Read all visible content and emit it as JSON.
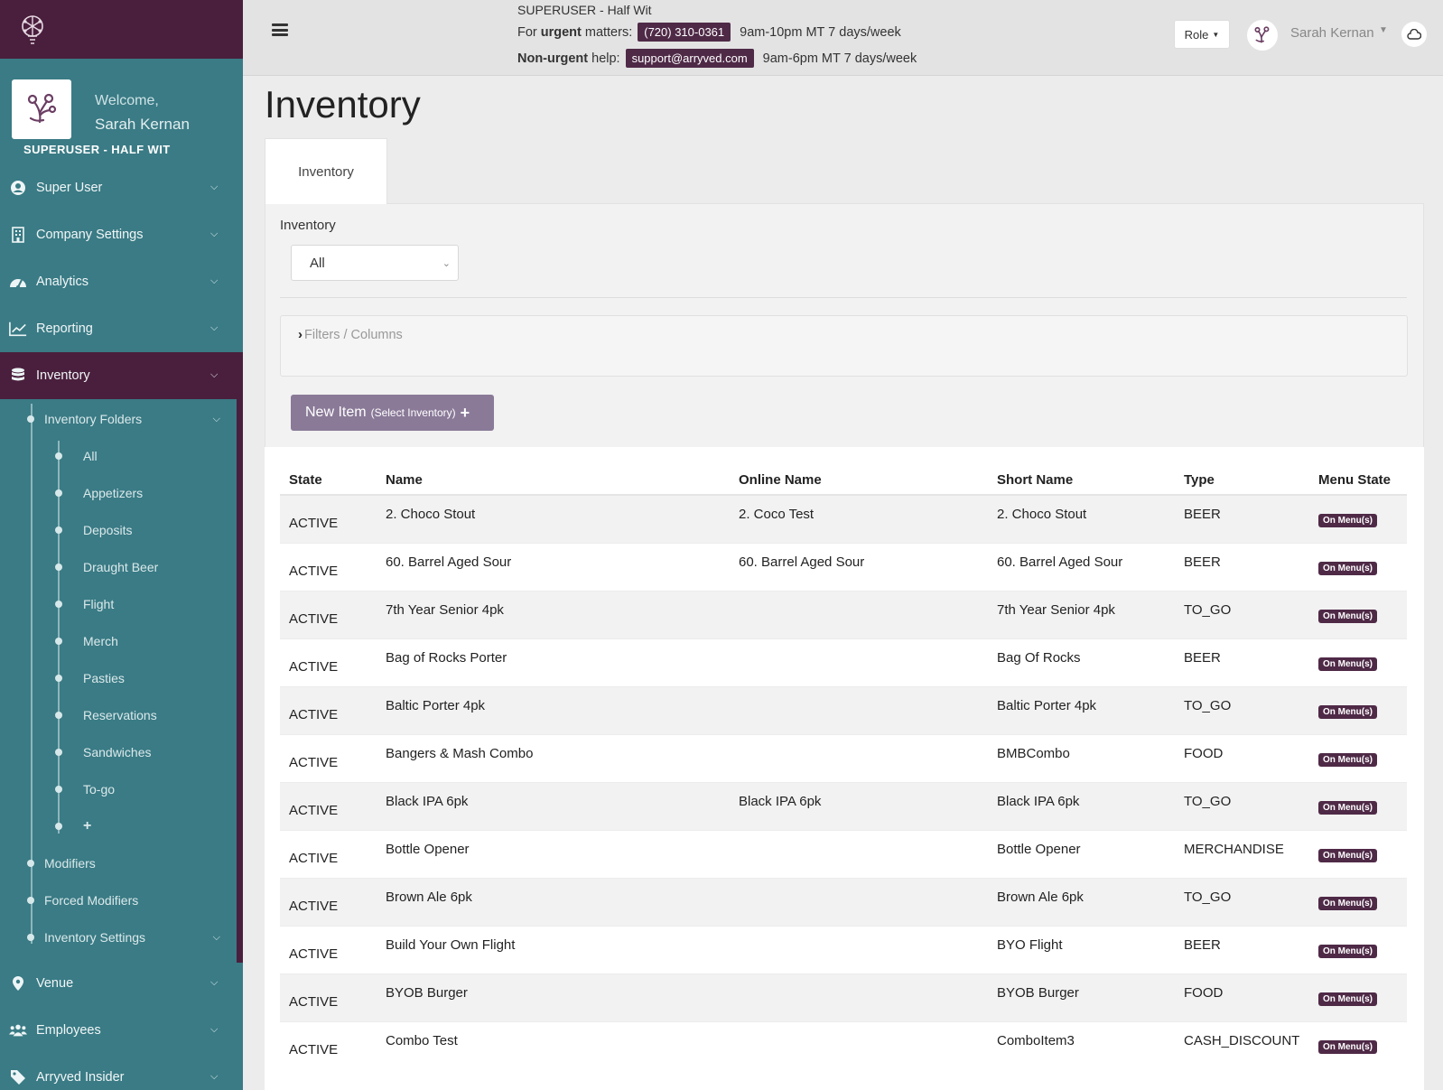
{
  "sidebar": {
    "welcome": "Welcome,",
    "username": "Sarah Kernan",
    "role": "SUPERUSER - HALF WIT",
    "items": [
      {
        "label": "Super User",
        "icon": "user-circle-icon"
      },
      {
        "label": "Company Settings",
        "icon": "building-icon"
      },
      {
        "label": "Analytics",
        "icon": "gauge-icon"
      },
      {
        "label": "Reporting",
        "icon": "line-chart-icon"
      },
      {
        "label": "Inventory",
        "icon": "database-icon"
      },
      {
        "label": "Venue",
        "icon": "map-pin-icon"
      },
      {
        "label": "Employees",
        "icon": "users-icon"
      },
      {
        "label": "Arryved Insider",
        "icon": "tag-icon"
      }
    ],
    "inventory_folders": "Inventory Folders",
    "folders": [
      "All",
      "Appetizers",
      "Deposits",
      "Draught Beer",
      "Flight",
      "Merch",
      "Pasties",
      "Reservations",
      "Sandwiches",
      "To-go",
      "+"
    ],
    "modifiers": "Modifiers",
    "forced_modifiers": "Forced Modifiers",
    "inventory_settings": "Inventory Settings"
  },
  "topbar": {
    "title": "SUPERUSER - Half Wit",
    "urgent_prefix": "For",
    "urgent_bold": "urgent",
    "urgent_suffix": "matters:",
    "phone": "(720) 310-0361",
    "urgent_hours": "9am-10pm MT 7 days/week",
    "nonurgent_bold": "Non-urgent",
    "nonurgent_suffix": "help:",
    "email": "support@arryved.com",
    "nonurgent_hours": "9am-6pm MT 7 days/week",
    "role_label": "Role",
    "user_name": "Sarah Kernan"
  },
  "main": {
    "title": "Inventory",
    "tab": "Inventory",
    "inventory_label": "Inventory",
    "select_value": "All",
    "filters": "Filters / Columns",
    "new_item": "New Item",
    "new_item_sub": "(Select Inventory)"
  },
  "table": {
    "headers": [
      "State",
      "Name",
      "Online Name",
      "Short Name",
      "Type",
      "Menu State"
    ],
    "rows": [
      [
        "ACTIVE",
        "2. Choco Stout",
        "2. Coco Test",
        "2. Choco Stout",
        "BEER",
        "On Menu(s)"
      ],
      [
        "ACTIVE",
        "60. Barrel Aged Sour",
        "60. Barrel Aged Sour",
        "60. Barrel Aged Sour",
        "BEER",
        "On Menu(s)"
      ],
      [
        "ACTIVE",
        "7th Year Senior 4pk",
        "",
        "7th Year Senior 4pk",
        "TO_GO",
        "On Menu(s)"
      ],
      [
        "ACTIVE",
        "Bag of Rocks Porter",
        "",
        "Bag Of Rocks",
        "BEER",
        "On Menu(s)"
      ],
      [
        "ACTIVE",
        "Baltic Porter 4pk",
        "",
        "Baltic Porter 4pk",
        "TO_GO",
        "On Menu(s)"
      ],
      [
        "ACTIVE",
        "Bangers & Mash Combo",
        "",
        "BMBCombo",
        "FOOD",
        "On Menu(s)"
      ],
      [
        "ACTIVE",
        "Black IPA 6pk",
        "Black IPA 6pk",
        "Black IPA 6pk",
        "TO_GO",
        "On Menu(s)"
      ],
      [
        "ACTIVE",
        "Bottle Opener",
        "",
        "Bottle Opener",
        "MERCHANDISE",
        "On Menu(s)"
      ],
      [
        "ACTIVE",
        "Brown Ale 6pk",
        "",
        "Brown Ale 6pk",
        "TO_GO",
        "On Menu(s)"
      ],
      [
        "ACTIVE",
        "Build Your Own Flight",
        "",
        "BYO Flight",
        "BEER",
        "On Menu(s)"
      ],
      [
        "ACTIVE",
        "BYOB Burger",
        "",
        "BYOB Burger",
        "FOOD",
        "On Menu(s)"
      ],
      [
        "ACTIVE",
        "Combo Test",
        "",
        "ComboItem3",
        "CASH_DISCOUNT",
        "On Menu(s)"
      ]
    ]
  },
  "colors": {
    "brand_purple": "#4a1f3d",
    "sidebar_teal": "#3a7b85",
    "badge_purple": "#4f2a47",
    "button_mauve": "#8a7a98"
  }
}
